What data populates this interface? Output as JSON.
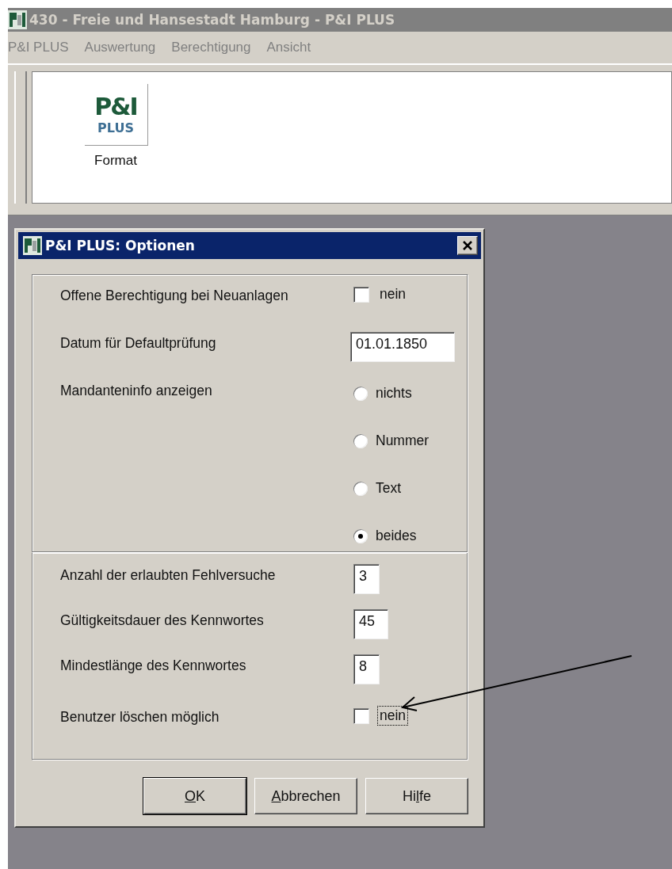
{
  "window": {
    "title": "430 - Freie und Hansestadt Hamburg - P&I PLUS",
    "active": false
  },
  "menu": [
    "P&I PLUS",
    "Auswertung",
    "Berechtigung",
    "Ansicht"
  ],
  "toolbar": {
    "buttons": [
      {
        "logo_top": "P&I",
        "logo_bottom": "PLUS",
        "label": "Format"
      }
    ]
  },
  "dialog": {
    "title": "P&I PLUS: Optionen",
    "groups": [
      {
        "rows": [
          {
            "kind": "checkbox",
            "label": "Offene Berechtigung bei Neuanlagen",
            "checked": false,
            "text": "nein",
            "focused": false
          },
          {
            "kind": "input",
            "label": "Datum für Defaultprüfung",
            "value": "01.01.1850"
          },
          {
            "kind": "radio",
            "label": "Mandanteninfo anzeigen",
            "options": [
              {
                "label": "nichts",
                "selected": false
              },
              {
                "label": "Nummer",
                "selected": false
              },
              {
                "label": "Text",
                "selected": false
              },
              {
                "label": "beides",
                "selected": true
              }
            ]
          }
        ]
      },
      {
        "rows": [
          {
            "kind": "input",
            "label": "Anzahl der erlaubten Fehlversuche",
            "value": "3"
          },
          {
            "kind": "input",
            "label": "Gültigkeitsdauer des Kennwortes",
            "value": "45"
          },
          {
            "kind": "input",
            "label": "Mindestlänge des Kennwortes",
            "value": "8"
          },
          {
            "kind": "checkbox",
            "label": "Benutzer löschen möglich",
            "checked": false,
            "text": "nein",
            "focused": true
          }
        ]
      }
    ],
    "buttons": [
      {
        "accel": "O",
        "after": "K",
        "default": true
      },
      {
        "accel": "A",
        "after": "bbrechen",
        "default": false
      },
      {
        "before": "Hi",
        "accel": "l",
        "after": "fe",
        "default": false
      }
    ]
  }
}
